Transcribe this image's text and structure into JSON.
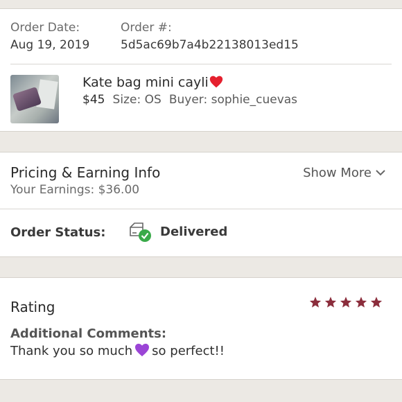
{
  "order": {
    "date_label": "Order Date:",
    "date_value": "Aug 19, 2019",
    "number_label": "Order #:",
    "number_value": "5d5ac69b7a4b22138013ed15"
  },
  "item": {
    "title": "Kate bag mini cayli",
    "price": "$45",
    "size": "Size: OS",
    "buyer": "Buyer: sophie_cuevas"
  },
  "pricing": {
    "title": "Pricing & Earning Info",
    "earnings": "Your Earnings: $36.00",
    "show_more": "Show More"
  },
  "status": {
    "label": "Order Status:",
    "value": "Delivered"
  },
  "rating": {
    "title": "Rating",
    "stars": 5,
    "star_color": "#8b2d3c",
    "comments_label": "Additional Comments:",
    "comment_part1": "Thank you so much",
    "comment_part2": "so perfect!!"
  },
  "colors": {
    "heart_red": "#e5202e",
    "heart_purple": "#9b45d6",
    "delivered_green": "#3aaa4a"
  }
}
